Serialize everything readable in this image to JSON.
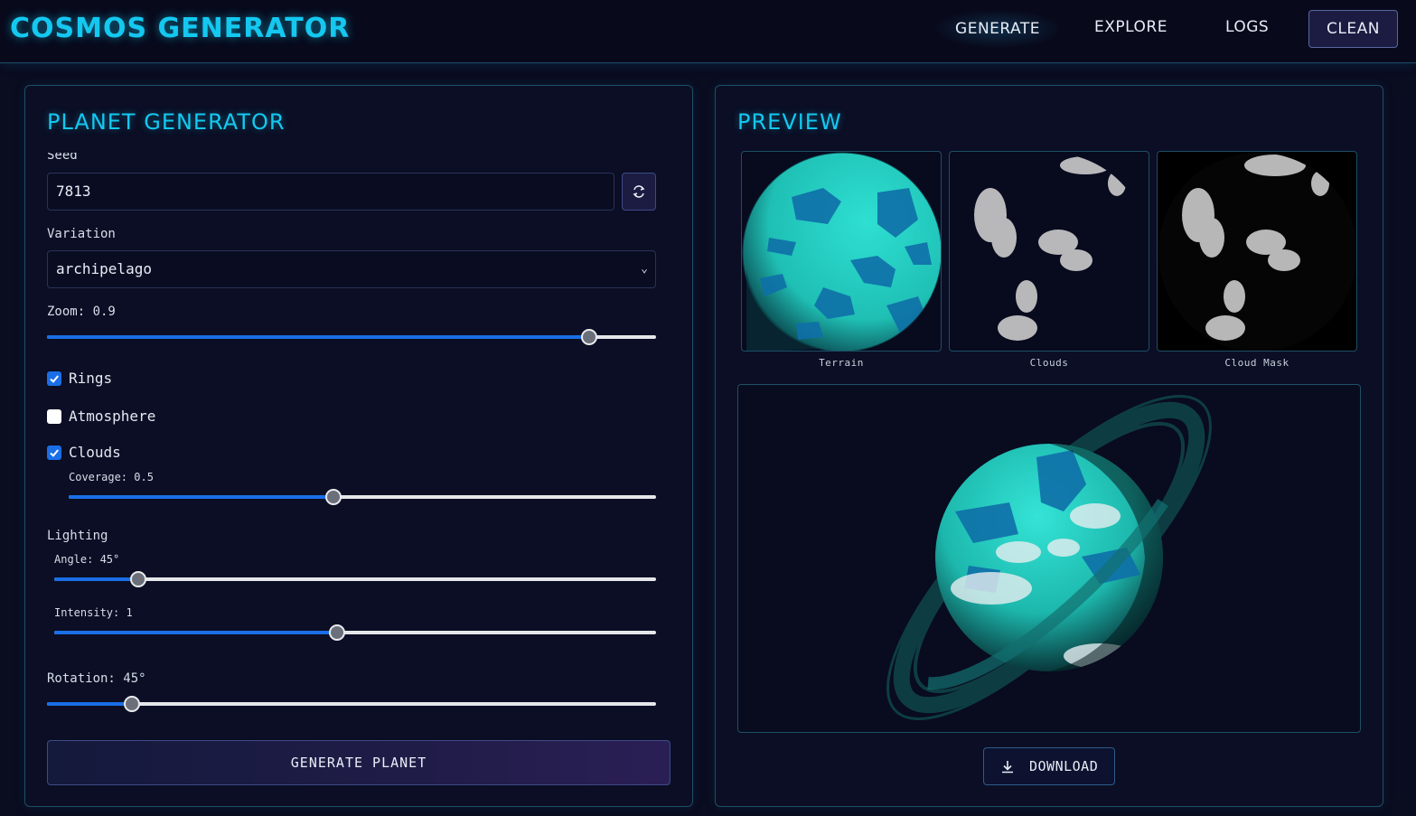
{
  "header": {
    "brand": "COSMOS GENERATOR",
    "nav": [
      "GENERATE",
      "EXPLORE",
      "LOGS"
    ],
    "clean_label": "CLEAN"
  },
  "generator": {
    "title": "PLANET GENERATOR",
    "seed_label": "Seed",
    "seed_value": "7813",
    "refresh_icon": "refresh-icon",
    "variation_label": "Variation",
    "variation_value": "archipelago",
    "zoom_label": "Zoom: 0.9",
    "zoom_fraction": 0.89,
    "rings_label": "Rings",
    "rings_checked": true,
    "atmosphere_label": "Atmosphere",
    "atmosphere_checked": false,
    "clouds_label": "Clouds",
    "clouds_checked": true,
    "coverage_label": "Coverage: 0.5",
    "coverage_fraction": 0.45,
    "lighting_label": "Lighting",
    "angle_label": "Angle: 45°",
    "angle_fraction": 0.14,
    "intensity_label": "Intensity: 1",
    "intensity_fraction": 0.47,
    "rotation_label": "Rotation: 45°",
    "rotation_fraction": 0.14,
    "generate_label": "GENERATE PLANET"
  },
  "preview": {
    "title": "PREVIEW",
    "captions": [
      "Terrain",
      "Clouds",
      "Cloud Mask"
    ],
    "download_label": "DOWNLOAD",
    "download_icon": "download-icon"
  },
  "colors": {
    "accent": "#14c8f0",
    "background": "#0a0c1f",
    "ocean": "#0f6fa8",
    "land": "#22d3c5",
    "slider_fill": "#1a6ee6"
  }
}
